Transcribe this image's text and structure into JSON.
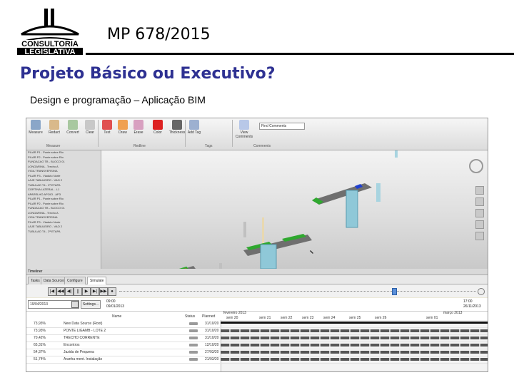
{
  "logo": {
    "line1": "CONSULTORIA",
    "line2": "LEGISLATIVA"
  },
  "header": {
    "title": "MP 678/2015"
  },
  "slide": {
    "heading": "Projeto Básico ou Executivo?",
    "subheading": "Design e programação – Aplicação BIM"
  },
  "app": {
    "ribbon": {
      "buttons": [
        {
          "label": "Measure",
          "icon": "ruler-icon"
        },
        {
          "label": "Redact",
          "icon": "redact-icon"
        },
        {
          "label": "Convert",
          "icon": "convert-icon"
        },
        {
          "label": "Clear",
          "icon": "clear-icon"
        },
        {
          "label": "Text",
          "icon": "text-icon"
        },
        {
          "label": "Draw",
          "icon": "draw-icon"
        },
        {
          "label": "Erase",
          "icon": "erase-icon"
        },
        {
          "label": "Color",
          "icon": "color-icon"
        },
        {
          "label": "Thickness",
          "icon": "thickness-icon"
        },
        {
          "label": "Add Tag",
          "icon": "tag-icon"
        },
        {
          "label": "View Comments",
          "icon": "comments-icon"
        }
      ],
      "find_label": "Find Comments",
      "groups": [
        "Measure",
        "Redline",
        "Tags",
        "Comments"
      ]
    },
    "selection_tree_lines": [
      "PILAR P1 - Ponte sobre Rio",
      "PILAR P2 - Ponte sobre Rio",
      "FUNDACAO TB - BLOCO 01",
      "LONGARINA - Trecho A",
      "VIGA TRANSVERSINA",
      "PILAR P3 - Viaduto Norte",
      "LAJE TABULEIRO - VAO 2",
      "TUBULAO T4 - 2ª ETAPA",
      "CORTINA LATERAL - L1",
      "APARELHO APOIO - AP3"
    ],
    "status_strip": "Timeliner",
    "tabs": [
      "Tasks",
      "Data Sources",
      "Configure",
      "Simulate"
    ],
    "toolbar": {
      "buttons": [
        "|◀",
        "◀◀",
        "◀|",
        "||",
        "▶",
        "▶|",
        "▶▶",
        "●"
      ]
    },
    "date_field": "19/04/2013",
    "settings_label": "Settings...",
    "time_start": "09:00",
    "date_start": "09/01/2013",
    "time_end": "17:00",
    "date_end": "26/11/2013",
    "gantt": {
      "headers": {
        "name": "Name",
        "status": "Status",
        "planned": "Planned"
      },
      "months": [
        "fevereiro 2013",
        "março 2013"
      ],
      "weeks": [
        "sem 20",
        "sem 21",
        "sem 22",
        "sem 23",
        "sem 24",
        "sem 25",
        "sem 26",
        "sem 01"
      ],
      "rows": [
        {
          "pct": "73,93%",
          "name": "New Data Source (Root)",
          "planned": "31/10/20"
        },
        {
          "pct": "73,93%",
          "name": "PONTE LIGAMB - LOTE 2",
          "planned": "31/10/20"
        },
        {
          "pct": "70,42%",
          "name": "TRECHO CORRENTE",
          "planned": "31/10/20"
        },
        {
          "pct": "65,31%",
          "name": "Encontros",
          "planned": "12/10/20"
        },
        {
          "pct": "54,37%",
          "name": "Jazida de Pequena",
          "planned": "27/03/20"
        },
        {
          "pct": "51,74%",
          "name": "Aranha ment. Instalação",
          "planned": "21/03/20"
        }
      ]
    }
  }
}
